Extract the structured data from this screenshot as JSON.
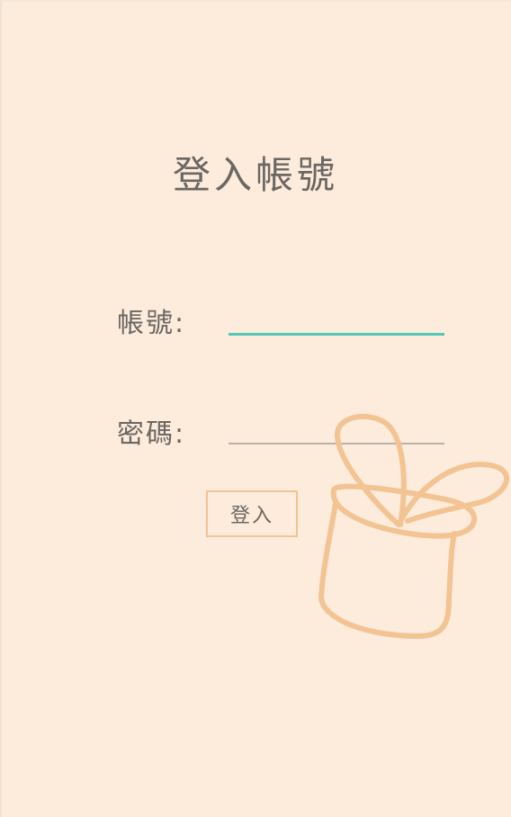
{
  "page": {
    "title": "登入帳號",
    "background": "#fdebdc"
  },
  "form": {
    "account_label": "帳號:",
    "account_value": "",
    "password_label": "密碼:",
    "password_value": "",
    "login_button_label": "登入"
  },
  "colors": {
    "accent_underline": "#4fc9b4",
    "plain_underline": "#b9b2ac",
    "illustration_stroke": "#f3c493",
    "text": "#6b6762"
  },
  "illustration": {
    "icon": "potted-plant-icon"
  }
}
